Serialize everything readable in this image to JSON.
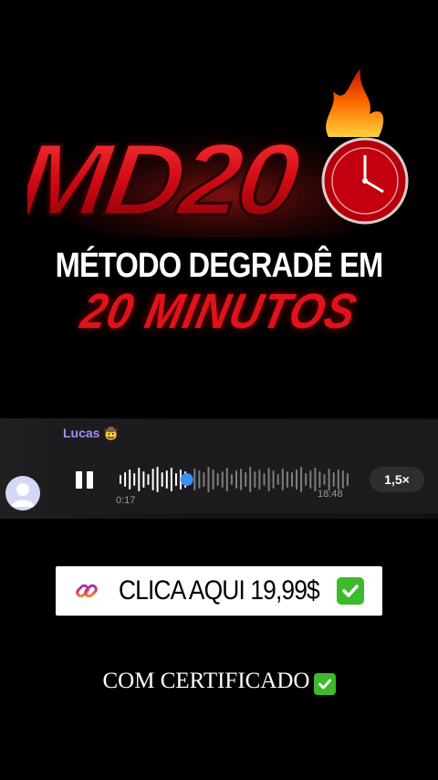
{
  "logo": {
    "text": "MD20"
  },
  "headline": "MÉTODO DEGRADÊ EM",
  "subheadline": "20 MINUTOS",
  "voice_message": {
    "sender": "Lucas",
    "sender_emoji": "🤠",
    "elapsed": "0:17",
    "duration": "18:48",
    "speed": "1,5×",
    "progress": 0.29
  },
  "cta": {
    "label": "CLICA AQUI 19,99$"
  },
  "footer": "COM CERTIFICADO",
  "colors": {
    "accent_red": "#e0121b",
    "sender": "#a58cf2",
    "check_green": "#3dba2c",
    "playhead": "#3a8ef6"
  }
}
